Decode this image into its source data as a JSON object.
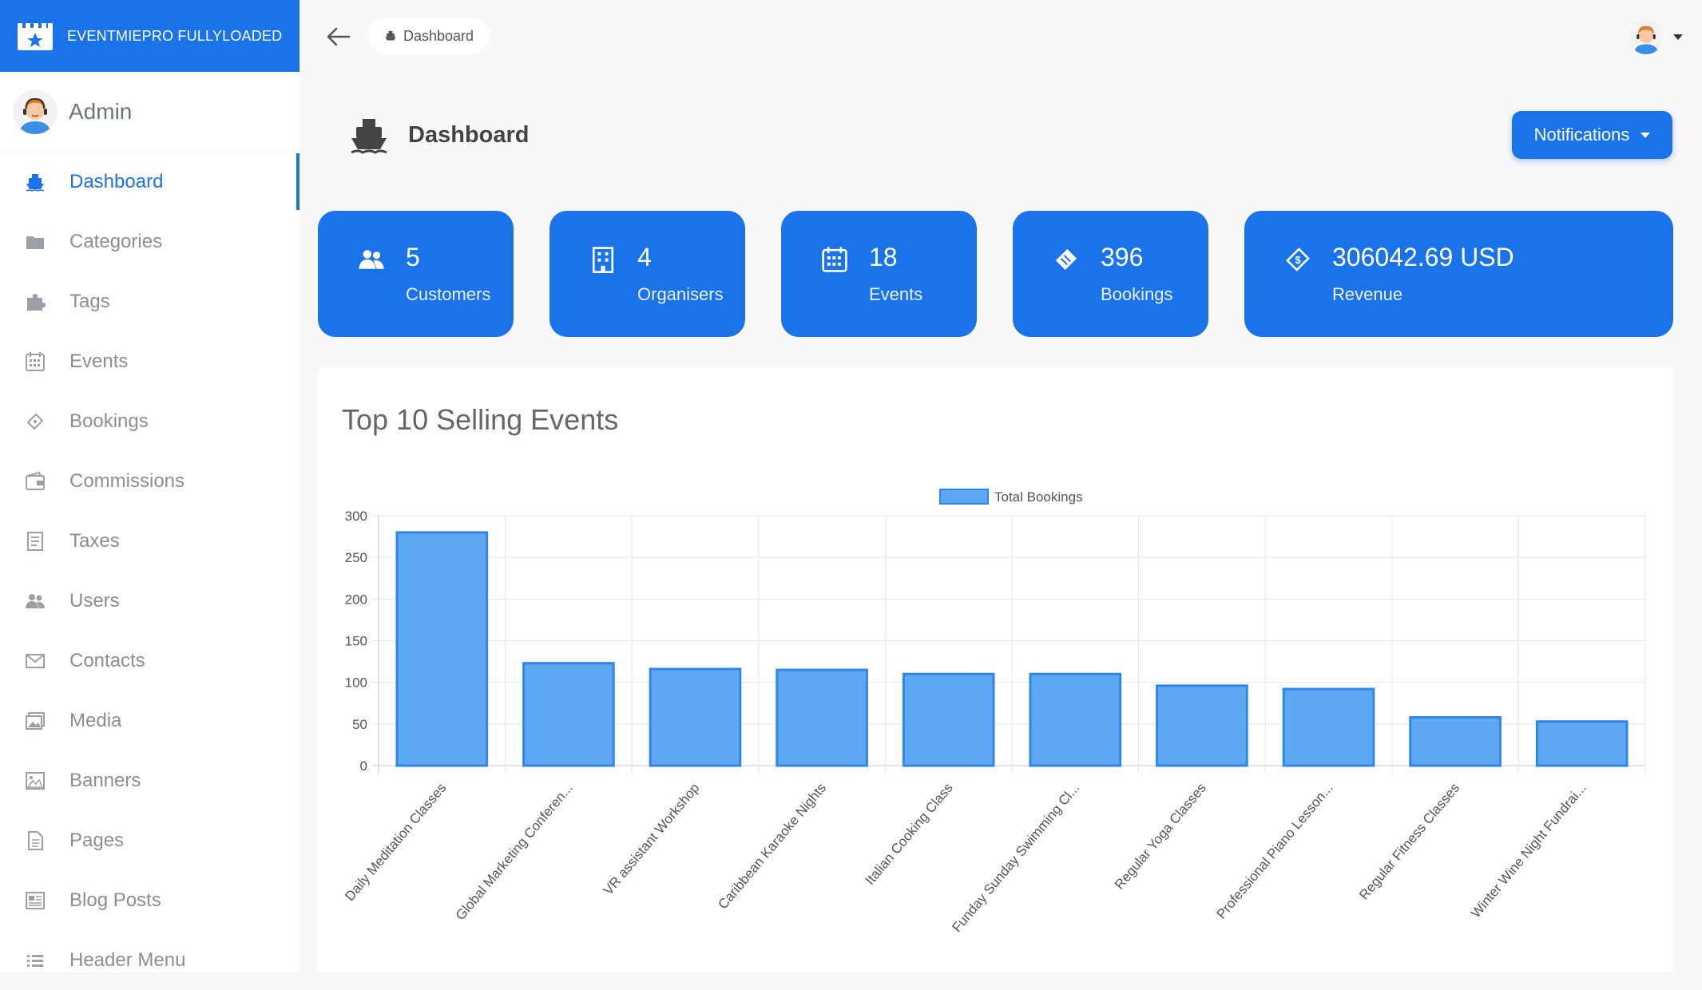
{
  "brand": {
    "name": "EVENTMIEPRO FULLYLOADED"
  },
  "user": {
    "name": "Admin"
  },
  "sidebar": {
    "items": [
      {
        "label": "Dashboard",
        "icon": "ship-icon",
        "active": true
      },
      {
        "label": "Categories",
        "icon": "folder-icon"
      },
      {
        "label": "Tags",
        "icon": "puzzle-icon"
      },
      {
        "label": "Events",
        "icon": "calendar-icon"
      },
      {
        "label": "Bookings",
        "icon": "ticket-icon"
      },
      {
        "label": "Commissions",
        "icon": "wallet-icon"
      },
      {
        "label": "Taxes",
        "icon": "receipt-icon"
      },
      {
        "label": "Users",
        "icon": "users-icon"
      },
      {
        "label": "Contacts",
        "icon": "envelope-icon"
      },
      {
        "label": "Media",
        "icon": "images-icon"
      },
      {
        "label": "Banners",
        "icon": "image-icon"
      },
      {
        "label": "Pages",
        "icon": "file-icon"
      },
      {
        "label": "Blog Posts",
        "icon": "newspaper-icon"
      },
      {
        "label": "Header Menu",
        "icon": "list-icon"
      }
    ]
  },
  "breadcrumb": {
    "label": "Dashboard"
  },
  "page": {
    "title": "Dashboard",
    "notifications_label": "Notifications"
  },
  "stats": [
    {
      "value": "5",
      "label": "Customers",
      "icon": "users-icon"
    },
    {
      "value": "4",
      "label": "Organisers",
      "icon": "building-icon"
    },
    {
      "value": "18",
      "label": "Events",
      "icon": "calendar-icon"
    },
    {
      "value": "396",
      "label": "Bookings",
      "icon": "ticket-icon"
    },
    {
      "value": "306042.69 USD",
      "label": "Revenue",
      "icon": "money-icon"
    }
  ],
  "colors": {
    "primary": "#1a73e8",
    "bar_fill": "#5ea7f2",
    "bar_stroke": "#2f86ea"
  },
  "panel": {
    "title": "Top 10 Selling Events"
  },
  "chart_data": {
    "type": "bar",
    "legend": "Total Bookings",
    "legend_position": "top",
    "categories": [
      "Daily Meditation Classes",
      "Global Marketing Conferen...",
      "VR assistant Workshop",
      "Caribbean Karaoke Nights",
      "Italian Cooking Class",
      "Funday Sunday Swimming Cl...",
      "Regular Yoga Classes",
      "Professional Piano Lesson...",
      "Regular Fitness Classes",
      "Winter Wine Night Fundrai..."
    ],
    "series": [
      {
        "name": "Total Bookings",
        "values": [
          280,
          123,
          116,
          115,
          110,
          110,
          96,
          92,
          58,
          53
        ]
      }
    ],
    "ylim": [
      0,
      300
    ],
    "yticks": [
      0,
      50,
      100,
      150,
      200,
      250,
      300
    ],
    "grid": true
  }
}
